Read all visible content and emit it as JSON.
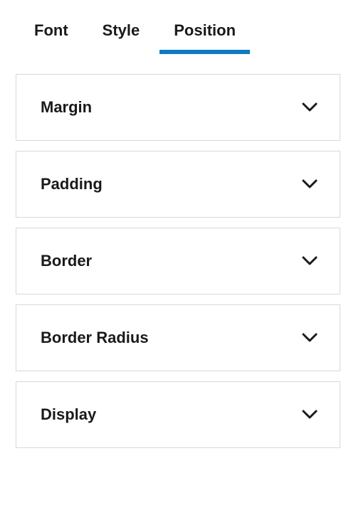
{
  "tabs": [
    {
      "label": "Font",
      "active": false
    },
    {
      "label": "Style",
      "active": false
    },
    {
      "label": "Position",
      "active": true
    }
  ],
  "panels": [
    {
      "label": "Margin"
    },
    {
      "label": "Padding"
    },
    {
      "label": "Border"
    },
    {
      "label": "Border Radius"
    },
    {
      "label": "Display"
    }
  ]
}
